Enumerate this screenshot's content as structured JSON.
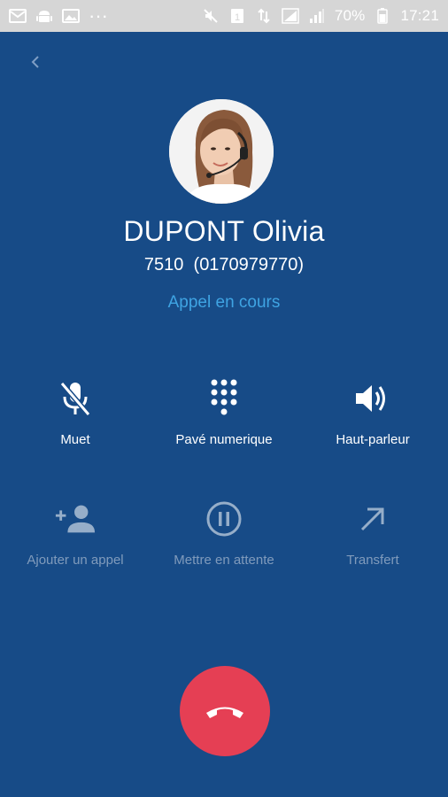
{
  "status_bar": {
    "battery": "70%",
    "time": "17:21",
    "sim": "1"
  },
  "caller": {
    "name": "DUPONT Olivia",
    "number": "7510  (0170979770)",
    "status": "Appel en cours"
  },
  "actions": {
    "mute": "Muet",
    "keypad": "Pavé numerique",
    "speaker": "Haut-parleur",
    "add_call": "Ajouter un appel",
    "hold": "Mettre en attente",
    "transfer": "Transfert"
  },
  "colors": {
    "background": "#174b87",
    "accent": "#3fa4e3",
    "end_call": "#e53f54"
  }
}
